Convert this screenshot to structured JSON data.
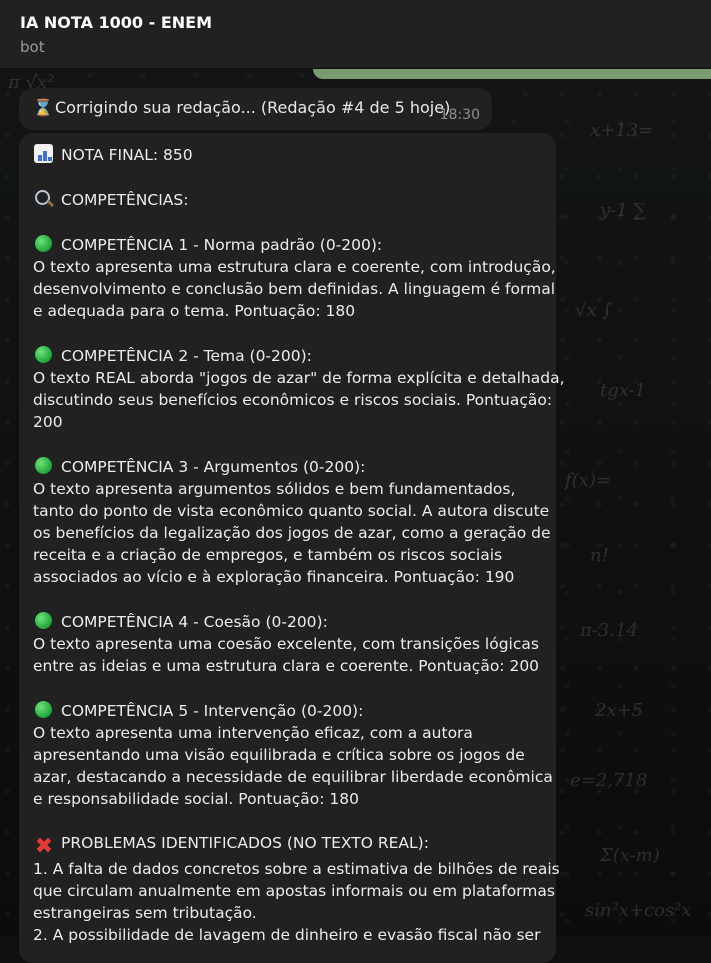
{
  "header": {
    "title": "IA NOTA 1000 - ENEM",
    "subtitle": "bot"
  },
  "status_message": {
    "icon": "hourglass-icon",
    "text": "Corrigindo sua redação... (Redação #4 de 5 hoje)",
    "time": "18:30"
  },
  "result_message": {
    "nota_final": "NOTA FINAL: 850",
    "competencias_heading": "COMPETÊNCIAS:",
    "competencias": [
      {
        "title": "COMPETÊNCIA 1 - Norma padrão (0-200):",
        "lines": [
          "O texto apresenta uma estrutura clara e coerente, com introdução,",
          "desenvolvimento e conclusão bem definidas. A linguagem é formal",
          "e adequada para o tema. Pontuação: 180"
        ]
      },
      {
        "title": "COMPETÊNCIA 2 - Tema (0-200):",
        "lines": [
          "O texto REAL aborda \"jogos de azar\" de forma explícita e detalhada,",
          "discutindo seus benefícios econômicos e riscos sociais. Pontuação:",
          "200"
        ]
      },
      {
        "title": "COMPETÊNCIA 3 - Argumentos (0-200):",
        "lines": [
          "O texto apresenta argumentos sólidos e bem fundamentados,",
          "tanto do ponto de vista econômico quanto social. A autora discute",
          "os benefícios da legalização dos jogos de azar, como a geração de",
          "receita e a criação de empregos, e também os riscos sociais",
          "associados ao vício e à exploração financeira. Pontuação: 190"
        ]
      },
      {
        "title": "COMPETÊNCIA 4 - Coesão (0-200):",
        "lines": [
          "O texto apresenta uma coesão excelente, com transições lógicas",
          "entre as ideias e uma estrutura clara e coerente. Pontuação: 200"
        ]
      },
      {
        "title": "COMPETÊNCIA 5 - Intervenção (0-200):",
        "lines": [
          "O texto apresenta uma intervenção eficaz, com a autora",
          "apresentando uma visão equilibrada e crítica sobre os jogos de",
          "azar, destacando a necessidade de equilibrar liberdade econômica",
          "e responsabilidade social. Pontuação: 180"
        ]
      }
    ],
    "problemas_heading": "PROBLEMAS IDENTIFICADOS (NO TEXTO REAL):",
    "problemas_lines": [
      "1. A falta de dados concretos sobre a estimativa de bilhões de reais",
      "que circulam anualmente em apostas informais ou em plataformas",
      "estrangeiras sem tributação.",
      "2. A possibilidade de lavagem de dinheiro e evasão fiscal não ser"
    ]
  },
  "colors": {
    "header_bg": "#212121",
    "bubble_bg": "#212121",
    "text": "#ececec",
    "muted": "#9a9a9a",
    "outgoing_bubble": "#7a9b72"
  }
}
